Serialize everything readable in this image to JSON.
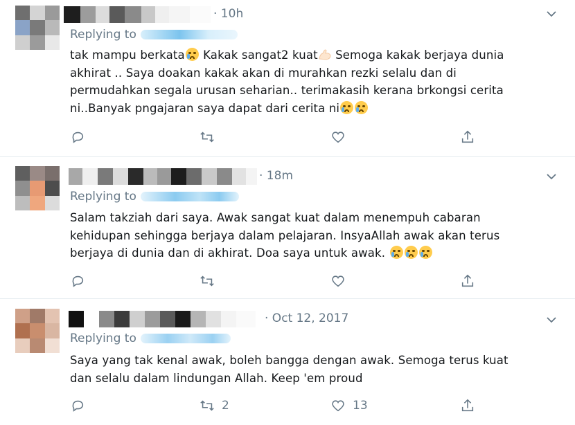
{
  "tweets": [
    {
      "time": "· 10h",
      "replying_label": "Replying to",
      "handle": "@·········y",
      "text_lines": [
        "tak mampu berkata",
        " Kakak sangat2 kuat",
        "  Semoga kakak berjaya dunia",
        "akhirat .. Saya doakan kakak akan di murahkan rezki selalu dan di",
        "permudahkan segala urusan seharian.. terimakasih kerana brkongsi cerita",
        "ni..Banyak pngajaran saya dapat dari cerita ni"
      ],
      "retweet_count": "",
      "like_count": ""
    },
    {
      "time": "· 18m",
      "replying_label": "Replying to",
      "handle": "@··········y",
      "text_lines": [
        "Salam takziah dari saya. Awak sangat kuat dalam menempuh cabaran",
        "kehidupan sehingga berjaya dalam pelajaran. InsyaAllah awak akan terus",
        "berjaya di dunia dan di akhirat. Doa saya untuk awak."
      ],
      "retweet_count": "",
      "like_count": ""
    },
    {
      "time": "· Oct 12, 2017",
      "replying_label": "Replying to",
      "handle": "@·········y",
      "text_lines": [
        "Saya yang tak kenal awak, boleh bangga dengan awak. Semoga terus kuat",
        "dan selalu dalam lindungan Allah. Keep 'em proud"
      ],
      "retweet_count": "2",
      "like_count": "13"
    }
  ],
  "icons": {
    "reply": "reply-icon",
    "retweet": "retweet-icon",
    "like": "heart-icon",
    "share": "share-icon",
    "caret": "chevron-down-icon"
  },
  "colors": {
    "secondary_text": "#657786",
    "divider": "#e6ecf0",
    "handle_blur": "#bfe3f7"
  }
}
